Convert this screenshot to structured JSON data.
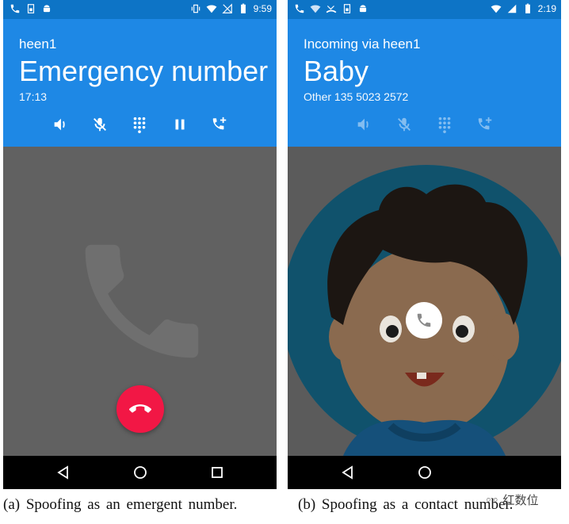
{
  "phone_a": {
    "status": {
      "time": "9:59",
      "icons": [
        "phone-icon",
        "sim-icon",
        "android-icon",
        "vibrate-icon",
        "wifi-icon",
        "no-signal-icon",
        "battery-icon"
      ]
    },
    "header": {
      "line_label": "heen1",
      "caller_name": "Emergency number",
      "sub_line": "17:13"
    },
    "controls": [
      "speaker-icon",
      "mute-icon",
      "dialpad-icon",
      "pause-icon",
      "add-call-icon"
    ],
    "nav": [
      "back-icon",
      "home-icon",
      "recents-icon"
    ],
    "colors": {
      "status": "#0d74c6",
      "header": "#1e88e5",
      "content": "#616161",
      "end_call": "#f21745"
    }
  },
  "phone_b": {
    "status": {
      "time": "2:19",
      "icons": [
        "phone-icon",
        "wifi-call-icon",
        "missed-call-icon",
        "sim-icon",
        "android-icon",
        "wifi-icon",
        "signal-icon",
        "battery-icon"
      ]
    },
    "header": {
      "line_label": "Incoming via heen1",
      "caller_name": "Baby",
      "sub_line": "Other 135 5023 2572"
    },
    "controls": [
      "speaker-icon",
      "mute-icon",
      "dialpad-icon",
      "add-call-icon"
    ],
    "nav": [
      "back-icon",
      "home-icon"
    ],
    "colors": {
      "header": "#1e88e5",
      "avatar_ring": "#1ea0cf",
      "answer_button": "#ffffff"
    }
  },
  "captions": {
    "a": "(a) Spoofing as an emergent number.",
    "b": "(b) Spoofing as a contact number."
  },
  "watermark": "红数位"
}
